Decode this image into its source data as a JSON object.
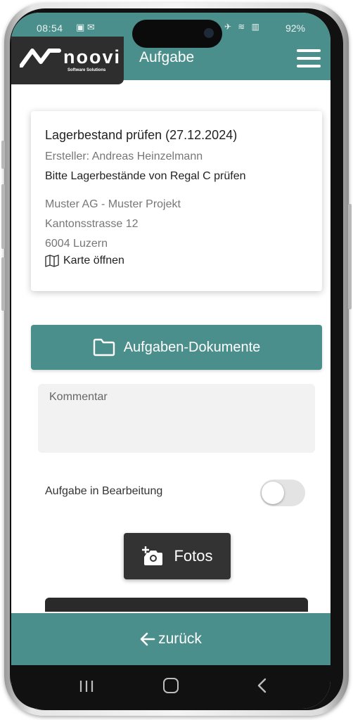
{
  "status_bar": {
    "time": "08:54",
    "left_icons": "▣ ✉",
    "right_icons": "✈ ≋ ▥",
    "battery": "92%"
  },
  "header": {
    "logo_text": "noovi",
    "logo_subtext": "Software Solutions",
    "title": "Aufgabe",
    "menu_icon": "hamburger-menu-icon"
  },
  "task": {
    "title": "Lagerbestand prüfen (27.12.2024)",
    "creator": "Ersteller: Andreas Heinzelmann",
    "description": "Bitte Lagerbestände von Regal C prüfen",
    "customer_project": "Muster AG - Muster Projekt",
    "street": "Kantonsstrasse 12",
    "city": "6004 Luzern",
    "map_link": "Karte öffnen"
  },
  "documents_button": {
    "label": "Aufgaben-Dokumente",
    "icon": "folder-icon"
  },
  "comment": {
    "placeholder": "Kommentar",
    "value": ""
  },
  "status_toggle": {
    "label": "Aufgabe in Bearbeitung",
    "on": false
  },
  "photos_button": {
    "label": "Fotos",
    "icon": "add-photo-icon"
  },
  "back_button": {
    "label": "zurück",
    "icon": "arrow-left-icon"
  },
  "colors": {
    "primary": "#4b8f8c",
    "dark": "#333333",
    "logo_bg": "#2e2e2e"
  }
}
